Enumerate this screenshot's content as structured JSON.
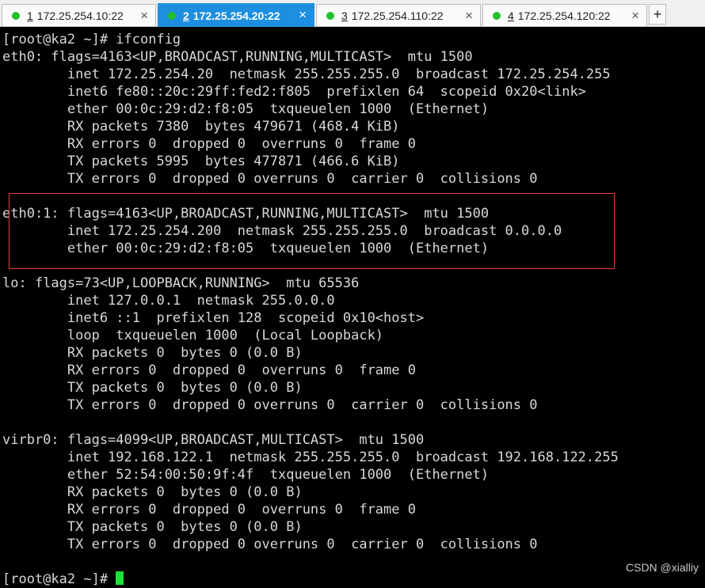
{
  "tabs": [
    {
      "num": "1",
      "label": "172.25.254.10:22",
      "active": false
    },
    {
      "num": "2",
      "label": "172.25.254.20:22",
      "active": true
    },
    {
      "num": "3",
      "label": "172.25.254.110:22",
      "active": false
    },
    {
      "num": "4",
      "label": "172.25.254.120:22",
      "active": false
    }
  ],
  "tab_close": "×",
  "new_tab": "+",
  "colors": {
    "tab_active": "#1e8fe0",
    "status_dot": "#23c12a",
    "cursor": "#1ee03a",
    "highlight_box": "#e0443c"
  },
  "terminal": {
    "lines": [
      "[root@ka2 ~]# ifconfig",
      "eth0: flags=4163<UP,BROADCAST,RUNNING,MULTICAST>  mtu 1500",
      "        inet 172.25.254.20  netmask 255.255.255.0  broadcast 172.25.254.255",
      "        inet6 fe80::20c:29ff:fed2:f805  prefixlen 64  scopeid 0x20<link>",
      "        ether 00:0c:29:d2:f8:05  txqueuelen 1000  (Ethernet)",
      "        RX packets 7380  bytes 479671 (468.4 KiB)",
      "        RX errors 0  dropped 0  overruns 0  frame 0",
      "        TX packets 5995  bytes 477871 (466.6 KiB)",
      "        TX errors 0  dropped 0 overruns 0  carrier 0  collisions 0",
      "",
      "eth0:1: flags=4163<UP,BROADCAST,RUNNING,MULTICAST>  mtu 1500",
      "        inet 172.25.254.200  netmask 255.255.255.0  broadcast 0.0.0.0",
      "        ether 00:0c:29:d2:f8:05  txqueuelen 1000  (Ethernet)",
      "",
      "lo: flags=73<UP,LOOPBACK,RUNNING>  mtu 65536",
      "        inet 127.0.0.1  netmask 255.0.0.0",
      "        inet6 ::1  prefixlen 128  scopeid 0x10<host>",
      "        loop  txqueuelen 1000  (Local Loopback)",
      "        RX packets 0  bytes 0 (0.0 B)",
      "        RX errors 0  dropped 0  overruns 0  frame 0",
      "        TX packets 0  bytes 0 (0.0 B)",
      "        TX errors 0  dropped 0 overruns 0  carrier 0  collisions 0",
      "",
      "virbr0: flags=4099<UP,BROADCAST,MULTICAST>  mtu 1500",
      "        inet 192.168.122.1  netmask 255.255.255.0  broadcast 192.168.122.255",
      "        ether 52:54:00:50:9f:4f  txqueuelen 1000  (Ethernet)",
      "        RX packets 0  bytes 0 (0.0 B)",
      "        RX errors 0  dropped 0  overruns 0  frame 0",
      "        TX packets 0  bytes 0 (0.0 B)",
      "        TX errors 0  dropped 0 overruns 0  carrier 0  collisions 0",
      "",
      "[root@ka2 ~]# "
    ]
  },
  "watermark": "CSDN @xialliy"
}
